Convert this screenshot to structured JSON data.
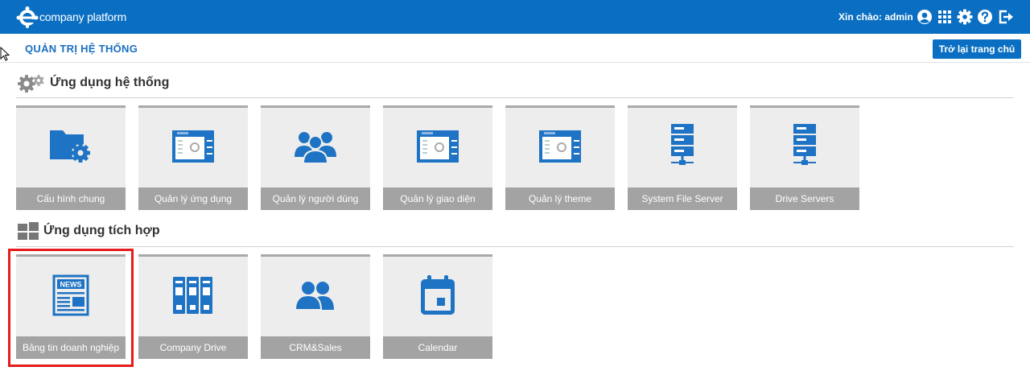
{
  "header": {
    "logo_text": "company platform",
    "greeting": "Xin chào: admin",
    "icons": [
      "user-icon",
      "apps-grid-icon",
      "gear-icon",
      "help-icon",
      "logout-icon"
    ],
    "background": "#0a6fc2"
  },
  "subheader": {
    "title": "QUẢN TRỊ HỆ THỐNG",
    "back_button": "Trở lại trang chủ"
  },
  "sections": [
    {
      "title": "Ứng dụng hệ thống",
      "icon": "gears-icon",
      "tiles": [
        {
          "label": "Cấu hình chung",
          "icon": "folder-gear-icon"
        },
        {
          "label": "Quản lý ứng dụng",
          "icon": "window-settings-icon"
        },
        {
          "label": "Quản lý người dùng",
          "icon": "users-icon"
        },
        {
          "label": "Quản lý giao diện",
          "icon": "window-settings-icon"
        },
        {
          "label": "Quản lý theme",
          "icon": "window-settings-icon"
        },
        {
          "label": "System File Server",
          "icon": "server-icon"
        },
        {
          "label": "Drive Servers",
          "icon": "server-icon"
        }
      ]
    },
    {
      "title": "Ứng dụng tích hợp",
      "icon": "windows-icon",
      "tiles": [
        {
          "label": "Bảng tin doanh nghiệp",
          "icon": "news-icon",
          "highlighted": true
        },
        {
          "label": "Company Drive",
          "icon": "binders-icon"
        },
        {
          "label": "CRM&Sales",
          "icon": "contacts-icon"
        },
        {
          "label": "Calendar",
          "icon": "calendar-icon"
        }
      ]
    }
  ],
  "colors": {
    "accent": "#0a6fc2",
    "icon_blue": "#1f73c4",
    "tile_bg": "#ededed",
    "tile_label_bg": "#a3a3a3",
    "highlight": "#e41c1c"
  }
}
